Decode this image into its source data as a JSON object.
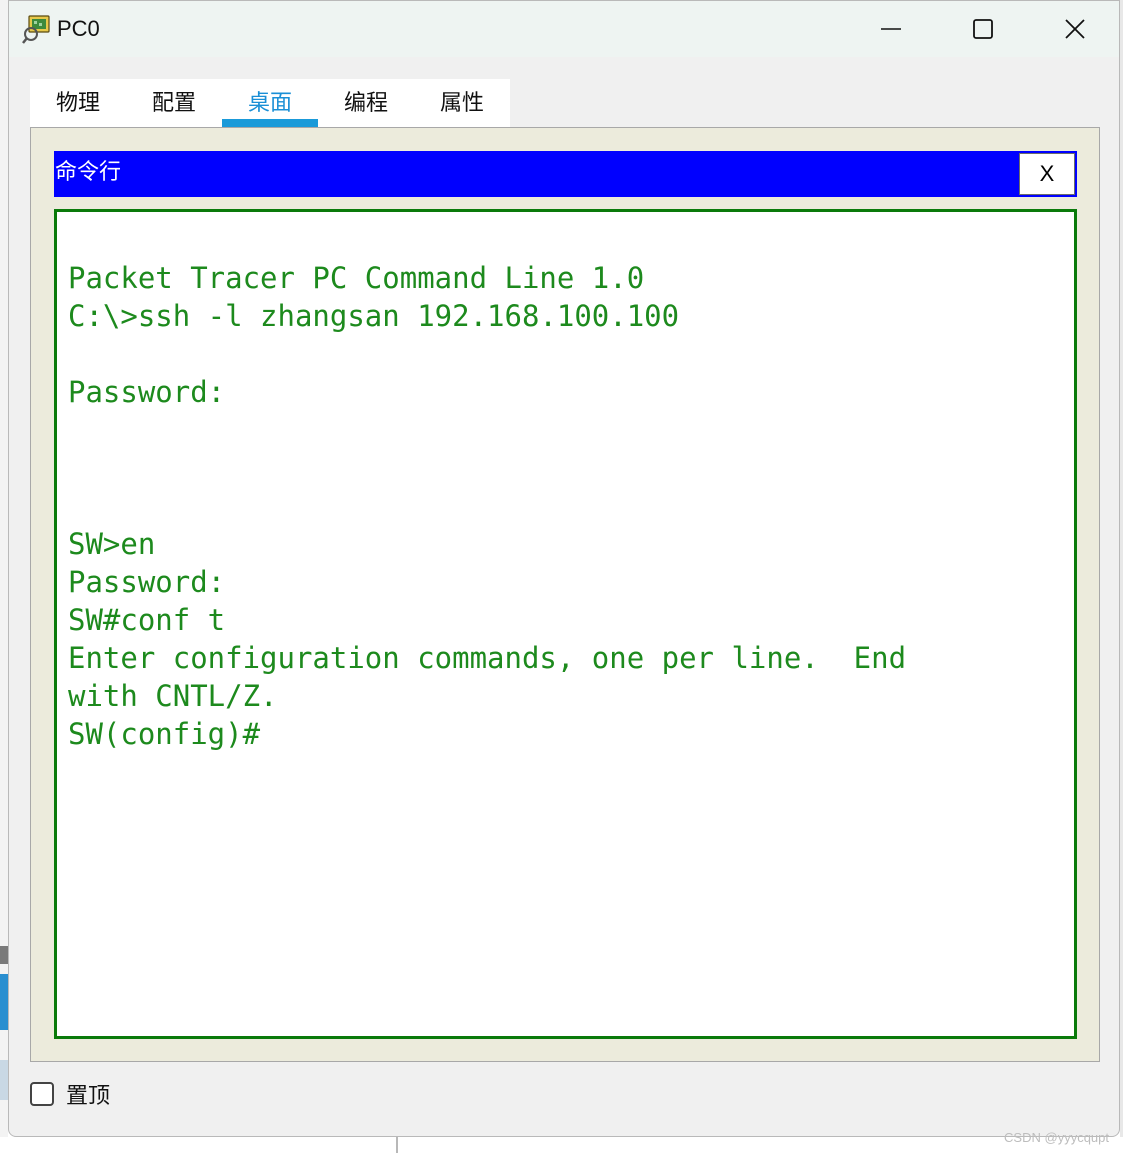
{
  "window": {
    "title": "PC0",
    "controls": {
      "minimize_icon": "minimize-icon",
      "maximize_icon": "maximize-icon",
      "close_icon": "close-icon"
    }
  },
  "tabs": [
    {
      "label": "物理",
      "active": false
    },
    {
      "label": "配置",
      "active": false
    },
    {
      "label": "桌面",
      "active": true
    },
    {
      "label": "编程",
      "active": false
    },
    {
      "label": "属性",
      "active": false
    }
  ],
  "command_prompt": {
    "title": "命令行",
    "close_label": "X",
    "output": "Packet Tracer PC Command Line 1.0\nC:\\>ssh -l zhangsan 192.168.100.100\n\nPassword:\n\n\n\nSW>en\nPassword:\nSW#conf t\nEnter configuration commands, one per line.  End\nwith CNTL/Z.\nSW(config)#"
  },
  "footer": {
    "always_on_top_label": "置顶",
    "always_on_top_checked": false
  },
  "watermark": "CSDN @yyycqupt",
  "colors": {
    "header_bar": "#0000ff",
    "terminal_text": "#1d8a1d",
    "terminal_border": "#0a7a0a",
    "active_tab": "#1a9ad9",
    "panel_bg": "#ecebdc"
  }
}
